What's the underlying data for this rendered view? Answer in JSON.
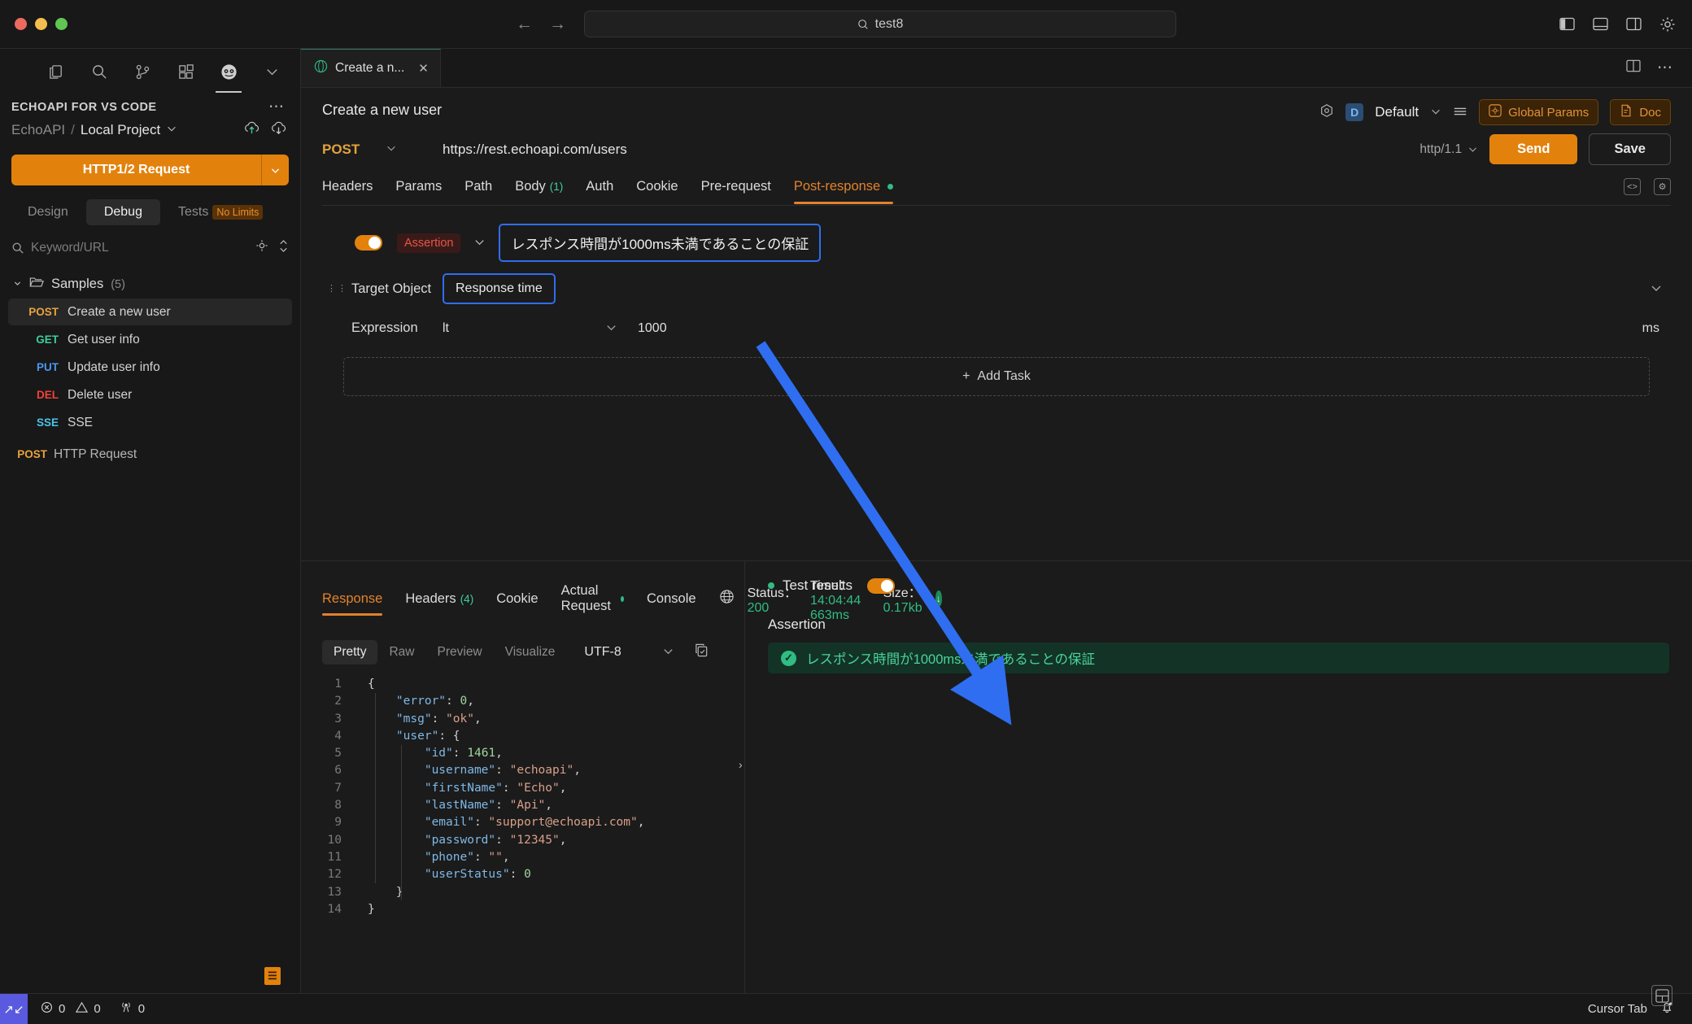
{
  "titlebar": {
    "omnibox_value": "test8",
    "back_icon": "arrow-left-icon",
    "forward_icon": "arrow-right-icon",
    "right_icons": [
      "panel-left-icon",
      "panel-bottom-icon",
      "panel-right-icon",
      "gear-icon"
    ]
  },
  "sidebar": {
    "activity_icons": [
      "files-icon",
      "search-icon",
      "source-control-icon",
      "extensions-icon",
      "echoapi-icon",
      "chevron-down-icon"
    ],
    "section_title": "ECHOAPI FOR VS CODE",
    "more_icon": "more-icon",
    "workspace": "EchoAPI",
    "separator": "/",
    "project": "Local Project",
    "project_chevron": "chevron-down-icon",
    "cloud_upload_icon": "cloud-upload-icon",
    "cloud_download_icon": "cloud-download-icon",
    "new_request_button": "HTTP1/2 Request",
    "segments": [
      {
        "label": "Design",
        "active": false
      },
      {
        "label": "Debug",
        "active": true
      },
      {
        "label": "Tests",
        "active": false,
        "badge": "No Limits"
      }
    ],
    "search_placeholder": "Keyword/URL",
    "search_icon": "search-icon",
    "locate_icon": "target-icon",
    "sort_icon": "sort-icon",
    "folder": {
      "name": "Samples",
      "count": "(5)",
      "icon": "folder-icon",
      "chevron": "chevron-down-icon"
    },
    "requests": [
      {
        "method": "POST",
        "name": "Create a new user",
        "selected": true,
        "cls": "m-post"
      },
      {
        "method": "GET",
        "name": "Get user info",
        "selected": false,
        "cls": "m-get"
      },
      {
        "method": "PUT",
        "name": "Update user info",
        "selected": false,
        "cls": "m-put"
      },
      {
        "method": "DEL",
        "name": "Delete user",
        "selected": false,
        "cls": "m-del"
      },
      {
        "method": "SSE",
        "name": "SSE",
        "selected": false,
        "cls": "m-sse"
      },
      {
        "method": "POST",
        "name": "HTTP Request",
        "selected": false,
        "cls": "m-post",
        "dim": true
      }
    ]
  },
  "editor_tab": {
    "icon": "http-icon",
    "label": "Create a n...",
    "close_icon": "close-icon",
    "split_icon": "split-editor-icon",
    "more_icon": "more-icon"
  },
  "request": {
    "title": "Create a new user",
    "method": "POST",
    "method_chevron": "chevron-down-icon",
    "url": "https://rest.echoapi.com/users",
    "http_version": "http/1.1",
    "send_label": "Send",
    "save_label": "Save",
    "env_icon": "environment-icon",
    "env_badge": "D",
    "env_name": "Default",
    "env_chevron": "chevron-down-icon",
    "menu_icon": "list-icon",
    "global_params_label": "Global Params",
    "global_params_icon": "gear-square-icon",
    "doc_label": "Doc",
    "doc_icon": "doc-icon",
    "tabs": [
      {
        "label": "Headers",
        "active": false
      },
      {
        "label": "Params",
        "active": false
      },
      {
        "label": "Path",
        "active": false
      },
      {
        "label": "Body",
        "count": "(1)",
        "active": false
      },
      {
        "label": "Auth",
        "active": false
      },
      {
        "label": "Cookie",
        "active": false
      },
      {
        "label": "Pre-request",
        "active": false
      },
      {
        "label": "Post-response",
        "active": true,
        "dot": true
      }
    ],
    "tab_right_icons": [
      "code-square-icon",
      "gear-square-icon"
    ]
  },
  "assertion": {
    "enabled": true,
    "tag": "Assertion",
    "collapse_icon": "chevron-down-icon",
    "name": "レスポンス時間が1000ms未満であることの保証",
    "grip_icon": "drag-handle-icon",
    "target_label": "Target Object",
    "target_value": "Response time",
    "row_collapse_icon": "chevron-down-icon",
    "expression_label": "Expression",
    "expression_operator": "lt",
    "operator_chevron": "chevron-down-icon",
    "expression_value": "1000",
    "unit": "ms",
    "add_task_label": "Add Task",
    "add_task_icon": "plus-icon"
  },
  "response": {
    "tabs": [
      {
        "label": "Response",
        "active": true
      },
      {
        "label": "Headers",
        "count": "(4)",
        "active": false
      },
      {
        "label": "Cookie",
        "active": false
      },
      {
        "label": "Actual Request",
        "active": false,
        "dot": true
      },
      {
        "label": "Console",
        "active": false
      }
    ],
    "globe_icon": "globe-icon",
    "status_label": "Status：",
    "status_value": "200",
    "time_label": "Time：",
    "time_value": "14:04:44 663ms",
    "size_label": "Size：",
    "size_value": "0.17kb",
    "download_icon": "download-icon",
    "formats": [
      {
        "label": "Pretty",
        "active": true
      },
      {
        "label": "Raw",
        "active": false
      },
      {
        "label": "Preview",
        "active": false
      },
      {
        "label": "Visualize",
        "active": false
      }
    ],
    "encoding": "UTF-8",
    "encoding_chevron": "chevron-down-icon",
    "copy_icon": "copy-icon",
    "expand_icon": "chevron-right-icon",
    "body_lines": [
      {
        "n": "1",
        "html": "<span class=\"p\">{</span>"
      },
      {
        "n": "2",
        "html": "    <span class=\"k\">\"error\"</span><span class=\"p\">: </span><span class=\"n\">0</span><span class=\"p\">,</span>"
      },
      {
        "n": "3",
        "html": "    <span class=\"k\">\"msg\"</span><span class=\"p\">: </span><span class=\"s\">\"ok\"</span><span class=\"p\">,</span>"
      },
      {
        "n": "4",
        "html": "    <span class=\"k\">\"user\"</span><span class=\"p\">: {</span>"
      },
      {
        "n": "5",
        "html": "        <span class=\"k\">\"id\"</span><span class=\"p\">: </span><span class=\"n\">1461</span><span class=\"p\">,</span>"
      },
      {
        "n": "6",
        "html": "        <span class=\"k\">\"username\"</span><span class=\"p\">: </span><span class=\"s\">\"echoapi\"</span><span class=\"p\">,</span>"
      },
      {
        "n": "7",
        "html": "        <span class=\"k\">\"firstName\"</span><span class=\"p\">: </span><span class=\"s\">\"Echo\"</span><span class=\"p\">,</span>"
      },
      {
        "n": "8",
        "html": "        <span class=\"k\">\"lastName\"</span><span class=\"p\">: </span><span class=\"s\">\"Api\"</span><span class=\"p\">,</span>"
      },
      {
        "n": "9",
        "html": "        <span class=\"k\">\"email\"</span><span class=\"p\">: </span><span class=\"s\">\"support@echoapi.com\"</span><span class=\"p\">,</span>"
      },
      {
        "n": "10",
        "html": "        <span class=\"k\">\"password\"</span><span class=\"p\">: </span><span class=\"s\">\"12345\"</span><span class=\"p\">,</span>"
      },
      {
        "n": "11",
        "html": "        <span class=\"k\">\"phone\"</span><span class=\"p\">: </span><span class=\"s\">\"\"</span><span class=\"p\">,</span>"
      },
      {
        "n": "12",
        "html": "        <span class=\"k\">\"userStatus\"</span><span class=\"p\">: </span><span class=\"n\">0</span>"
      },
      {
        "n": "13",
        "html": "    <span class=\"p\">}</span>"
      },
      {
        "n": "14",
        "html": "<span class=\"p\">}</span>"
      }
    ]
  },
  "test_results": {
    "label": "Test results",
    "enabled": true,
    "assertion_heading": "Assertion",
    "items": [
      {
        "label": "レスポンス時間が1000ms未満であることの保証",
        "passed": true,
        "icon": "check-circle-icon"
      }
    ],
    "grid_icon": "layout-icon"
  },
  "statusbar": {
    "logo_icon": "cursor-logo-icon",
    "errors_icon": "error-icon",
    "errors": "0",
    "warnings_icon": "warning-icon",
    "warnings": "0",
    "ports_icon": "radio-tower-icon",
    "ports": "0",
    "cursor_tab": "Cursor Tab",
    "bell_icon": "bell-dot-icon"
  },
  "colors": {
    "accent_orange": "#e2820d",
    "green": "#2fbd84",
    "annotation_blue": "#2f6ef0"
  }
}
